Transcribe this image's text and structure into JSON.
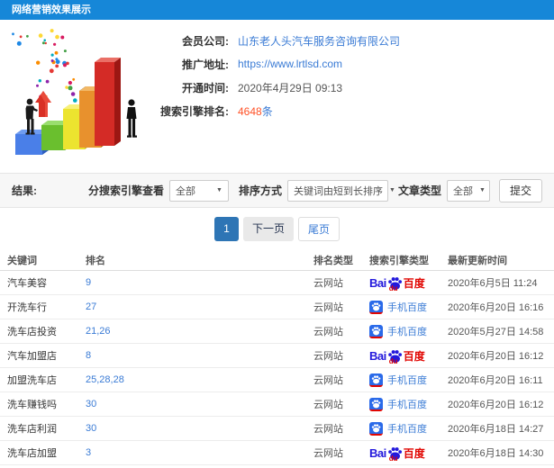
{
  "header": {
    "title": "网络营销效果展示"
  },
  "info": {
    "fields": [
      {
        "label": "会员公司:",
        "value": "山东老人头汽车服务咨询有限公司",
        "type": "link"
      },
      {
        "label": "推广地址:",
        "value": "https://www.lrtlsd.com",
        "type": "link"
      },
      {
        "label": "开通时间:",
        "value": "2020年4月29日 09:13",
        "type": "text"
      },
      {
        "label": "搜索引擎排名:",
        "value": "4648",
        "suffix": "条",
        "type": "count"
      }
    ]
  },
  "filters": {
    "result_label": "结果:",
    "engine_label": "分搜索引擎查看",
    "engine_value": "全部",
    "sort_label": "排序方式",
    "sort_value": "关键词由短到长排序",
    "article_label": "文章类型",
    "article_value": "全部",
    "submit_label": "提交"
  },
  "pagination": {
    "current": "1",
    "next": "下一页",
    "last": "尾页"
  },
  "table": {
    "headers": [
      "关键词",
      "排名",
      "排名类型",
      "搜索引擎类型",
      "最新更新时间"
    ],
    "engine_labels": {
      "baidu_bai": "Bai",
      "baidu_du": "du",
      "baidu_cn": "百度",
      "mobile_cn": "手机百度"
    },
    "rows": [
      {
        "keyword": "汽车美容",
        "rank": "9",
        "rank_type": "云网站",
        "engine": "baidu",
        "time": "2020年6月5日 11:24"
      },
      {
        "keyword": "开洗车行",
        "rank": "27",
        "rank_type": "云网站",
        "engine": "mobile-baidu",
        "time": "2020年6月20日 16:16"
      },
      {
        "keyword": "洗车店投资",
        "rank": "21,26",
        "rank_type": "云网站",
        "engine": "mobile-baidu",
        "time": "2020年5月27日 14:58"
      },
      {
        "keyword": "汽车加盟店",
        "rank": "8",
        "rank_type": "云网站",
        "engine": "baidu",
        "time": "2020年6月20日 16:12"
      },
      {
        "keyword": "加盟洗车店",
        "rank": "25,28,28",
        "rank_type": "云网站",
        "engine": "mobile-baidu",
        "time": "2020年6月20日 16:11"
      },
      {
        "keyword": "洗车赚钱吗",
        "rank": "30",
        "rank_type": "云网站",
        "engine": "mobile-baidu",
        "time": "2020年6月20日 16:12"
      },
      {
        "keyword": "洗车店利润",
        "rank": "30",
        "rank_type": "云网站",
        "engine": "mobile-baidu",
        "time": "2020年6月18日 14:27"
      },
      {
        "keyword": "洗车店加盟",
        "rank": "3",
        "rank_type": "云网站",
        "engine": "baidu",
        "time": "2020年6月18日 14:30"
      }
    ]
  },
  "colors": {
    "header_bg": "#1687d8",
    "link_blue": "#3a7bd5",
    "count_red": "#ff5126",
    "baidu_blue": "#2319dc",
    "baidu_red": "#e10602",
    "pagination_active": "#2e75b5",
    "filter_bg": "#f7f7f7"
  }
}
